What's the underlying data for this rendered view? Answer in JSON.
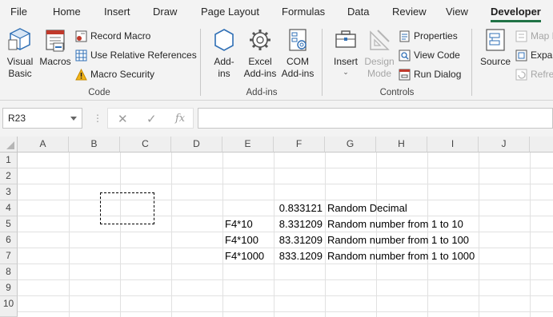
{
  "menu": {
    "tabs": [
      "File",
      "Home",
      "Insert",
      "Draw",
      "Page Layout",
      "Formulas",
      "Data",
      "Review",
      "View",
      "Developer"
    ],
    "active": "Developer"
  },
  "ribbon": {
    "code": {
      "label": "Code",
      "visual_basic": [
        "Visual",
        "Basic"
      ],
      "macros": "Macros",
      "record_macro": "Record Macro",
      "relative_refs": "Use Relative References",
      "macro_security": "Macro Security"
    },
    "addins": {
      "label": "Add-ins",
      "addins": [
        "Add-",
        "ins"
      ],
      "excel_addins": [
        "Excel",
        "Add-ins"
      ],
      "com_addins": [
        "COM",
        "Add-ins"
      ]
    },
    "controls": {
      "label": "Controls",
      "insert": "Insert",
      "design_mode": [
        "Design",
        "Mode"
      ],
      "properties": "Properties",
      "view_code": "View Code",
      "run_dialog": "Run Dialog"
    },
    "xml": {
      "source": "Source",
      "map_properties": "Map P",
      "expansion_packs": "Expar",
      "refresh_data": "Refres"
    }
  },
  "formula_bar": {
    "name_box": "R23",
    "cancel": "✕",
    "enter": "✓",
    "fx": "fx",
    "formula": ""
  },
  "grid": {
    "columns": [
      "A",
      "B",
      "C",
      "D",
      "E",
      "F",
      "G",
      "H",
      "I",
      "J"
    ],
    "rows": [
      "1",
      "2",
      "3",
      "4",
      "5",
      "6",
      "7",
      "8",
      "9",
      "10"
    ],
    "cells": {
      "F4": "0.833121",
      "G4": "Random Decimal",
      "E5": "F4*10",
      "F5": "8.331209",
      "G5": "Random number from 1 to 10",
      "E6": "F4*100",
      "F6": "83.31209",
      "G6": "Random number from 1 to 100",
      "E7": "F4*1000",
      "F7": "833.1209",
      "G7": "Random number from 1 to 1000"
    }
  },
  "colors": {
    "accent": "#217346",
    "ribbon_bg": "#f3f3f3",
    "header_bg": "#efefef",
    "gridline": "#e1e1e1"
  }
}
